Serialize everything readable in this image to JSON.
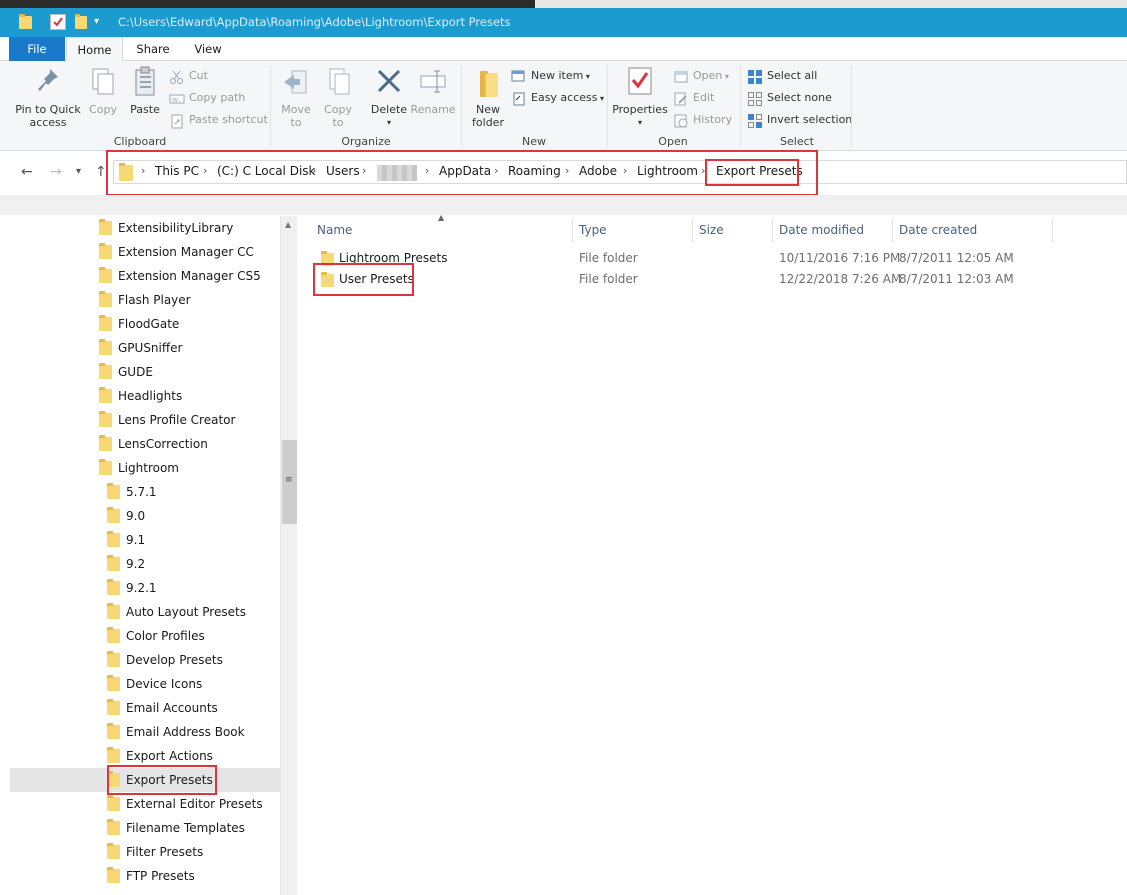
{
  "window": {
    "title_path": "C:\\Users\\Edward\\AppData\\Roaming\\Adobe\\Lightroom\\Export Presets"
  },
  "tabs": {
    "file": "File",
    "home": "Home",
    "share": "Share",
    "view": "View"
  },
  "ribbon": {
    "clipboard": {
      "label": "Clipboard",
      "pin_l1": "Pin to Quick",
      "pin_l2": "access",
      "copy": "Copy",
      "paste": "Paste",
      "cut": "Cut",
      "copy_path": "Copy path",
      "paste_shortcut": "Paste shortcut"
    },
    "organize": {
      "label": "Organize",
      "move_l1": "Move",
      "move_l2": "to",
      "copy_l1": "Copy",
      "copy_l2": "to",
      "delete": "Delete",
      "rename": "Rename"
    },
    "new": {
      "label": "New",
      "new_folder_l1": "New",
      "new_folder_l2": "folder",
      "new_item": "New item",
      "easy_access": "Easy access"
    },
    "open": {
      "label": "Open",
      "properties": "Properties",
      "open": "Open",
      "edit": "Edit",
      "history": "History"
    },
    "select": {
      "label": "Select",
      "select_all": "Select all",
      "select_none": "Select none",
      "invert": "Invert selection"
    }
  },
  "breadcrumb": {
    "items": [
      "This PC",
      "(C:) C Local Disk",
      "Users",
      "AppData",
      "Roaming",
      "Adobe",
      "Lightroom",
      "Export Presets"
    ]
  },
  "nav": {
    "items": [
      "ExtensibilityLibrary",
      "Extension Manager CC",
      "Extension Manager CS5",
      "Flash Player",
      "FloodGate",
      "GPUSniffer",
      "GUDE",
      "Headlights",
      "Lens Profile Creator",
      "LensCorrection",
      "Lightroom",
      "5.7.1",
      "9.0",
      "9.1",
      "9.2",
      "9.2.1",
      "Auto Layout Presets",
      "Color Profiles",
      "Develop Presets",
      "Device Icons",
      "Email Accounts",
      "Email Address Book",
      "Export Actions",
      "Export Presets",
      "External Editor Presets",
      "Filename Templates",
      "Filter Presets",
      "FTP Presets"
    ]
  },
  "filelist": {
    "columns": {
      "name": "Name",
      "type": "Type",
      "size": "Size",
      "modified": "Date modified",
      "created": "Date created"
    },
    "rows": [
      {
        "name": "Lightroom Presets",
        "type": "File folder",
        "size": "",
        "modified": "10/11/2016 7:16 PM",
        "created": "8/7/2011 12:05 AM"
      },
      {
        "name": "User Presets",
        "type": "File folder",
        "size": "",
        "modified": "12/22/2018 7:26 AM",
        "created": "8/7/2011 12:03 AM"
      }
    ]
  }
}
